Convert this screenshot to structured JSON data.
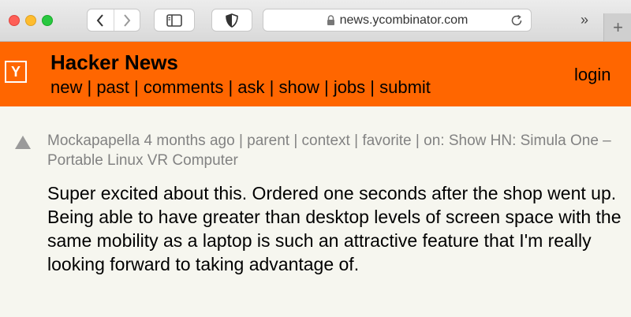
{
  "browser": {
    "url": "news.ycombinator.com",
    "more_glyph": "»",
    "newtab_glyph": "+"
  },
  "header": {
    "logo": "Y",
    "title": "Hacker News",
    "nav": [
      "new",
      "past",
      "comments",
      "ask",
      "show",
      "jobs",
      "submit"
    ],
    "separator": " | ",
    "login": "login",
    "color": "#ff6600"
  },
  "comment": {
    "user": "Mockapapella",
    "age": "4 months ago",
    "links": [
      "parent",
      "context",
      "favorite"
    ],
    "on_label": "on:",
    "story": "Show HN: Simula One – Portable Linux VR Computer",
    "text": "Super excited about this. Ordered one seconds after the shop went up. Being able to have greater than desktop levels of screen space with the same mobility as a laptop is such an attractive feature that I'm really looking forward to taking advantage of."
  }
}
